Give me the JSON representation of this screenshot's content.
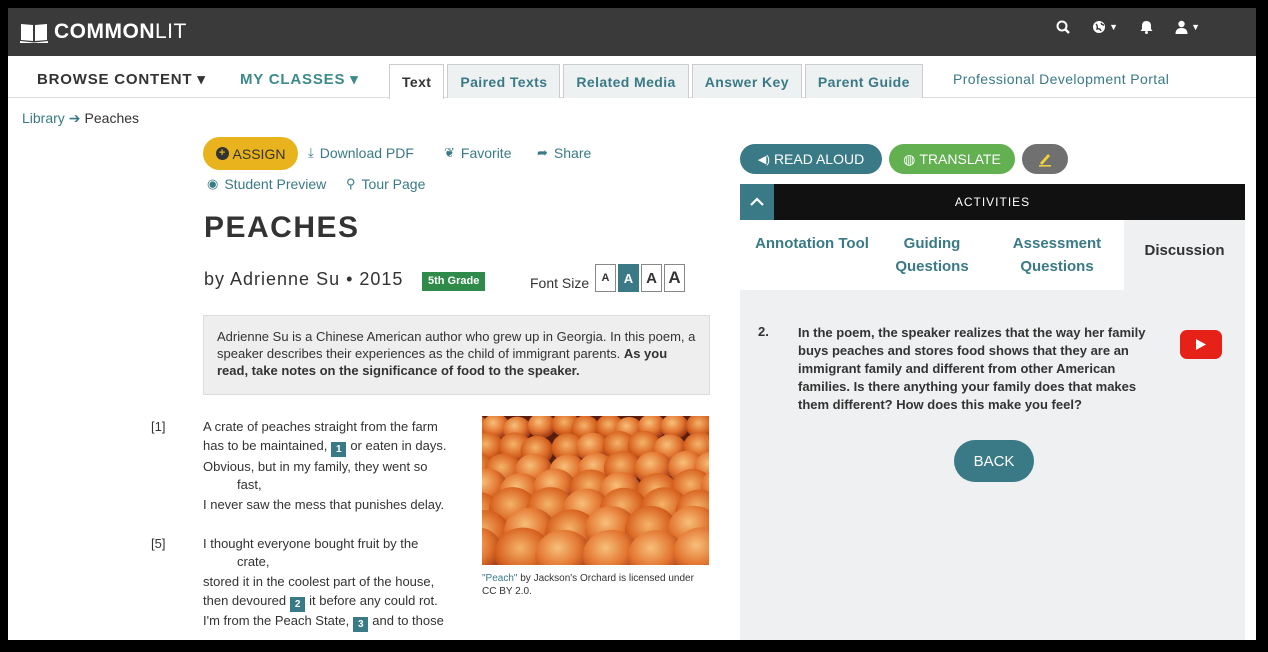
{
  "header": {
    "logo_strong": "COMMON",
    "logo_light": "LIT"
  },
  "nav": {
    "browse": "BROWSE CONTENT ▾",
    "classes": "MY CLASSES ▾",
    "tabs": [
      {
        "label": "Text",
        "active": true
      },
      {
        "label": "Paired Texts",
        "active": false
      },
      {
        "label": "Related Media",
        "active": false
      },
      {
        "label": "Answer Key",
        "active": false
      },
      {
        "label": "Parent Guide",
        "active": false
      }
    ],
    "pd_portal": "Professional Development Portal"
  },
  "breadcrumb": {
    "library": "Library",
    "current": "Peaches"
  },
  "actions": {
    "assign": "ASSIGN",
    "download": "Download PDF",
    "favorite": "Favorite",
    "share": "Share",
    "preview": "Student Preview",
    "tour": "Tour Page"
  },
  "text": {
    "title": "PEACHES",
    "byline": "by Adrienne Su • 2015",
    "grade": "5th Grade",
    "font_size_label": "Font Size",
    "font_sizes": [
      "A",
      "A",
      "A",
      "A"
    ],
    "intro_plain": "Adrienne Su is a Chinese American author who grew up in Georgia. In this poem, a speaker describes their experiences as the child of immigrant parents.",
    "intro_bold": "As you read, take notes on the significance of food to the speaker."
  },
  "poem": {
    "line_numbers": [
      "[1]",
      "[5]"
    ],
    "lines": [
      "A crate of peaches straight from the farm",
      "has to be maintained,",
      "or eaten in days.",
      "Obvious, but in my family, they went so",
      "fast,",
      "I never saw the mess that punishes delay.",
      "I thought everyone bought fruit by the",
      "crate,",
      "stored it in the coolest part of the house,",
      "then devoured",
      "it before any could rot.",
      "I'm from the Peach State,",
      "and to those"
    ],
    "footnotes": [
      "1",
      "2",
      "3"
    ]
  },
  "image": {
    "caption_link": "\"Peach\"",
    "caption_text": " by Jackson's Orchard is licensed under CC BY 2.0."
  },
  "panel": {
    "read_aloud": "READ ALOUD",
    "translate": "TRANSLATE",
    "activities": "ACTIVITIES",
    "tabs": [
      {
        "label": "Annotation Tool",
        "active": false
      },
      {
        "label": "Guiding Questions",
        "active": false
      },
      {
        "label": "Assessment Questions",
        "active": false
      },
      {
        "label": "Discussion",
        "active": true
      }
    ],
    "question_number": "2.",
    "question": "In the poem, the speaker realizes that the way her family buys peaches and stores food shows that they are an immigrant family and different from other American families. Is there anything your family does that makes them different? How does this make you feel?",
    "back": "BACK"
  },
  "colors": {
    "topbar": "#3a3a3a",
    "teal": "#3a7a87",
    "assign": "#e8b31d",
    "translate": "#62b04f",
    "grade": "#2e8b4a",
    "youtube": "#e62117"
  },
  "icons": [
    "book-icon",
    "search-icon",
    "globe-icon",
    "bell-icon",
    "user-icon",
    "download-icon",
    "favorite-icon",
    "share-icon",
    "eye-icon",
    "tour-icon",
    "speaker-icon",
    "globe-icon",
    "highlighter-icon",
    "chevron-up-icon",
    "youtube-icon"
  ]
}
